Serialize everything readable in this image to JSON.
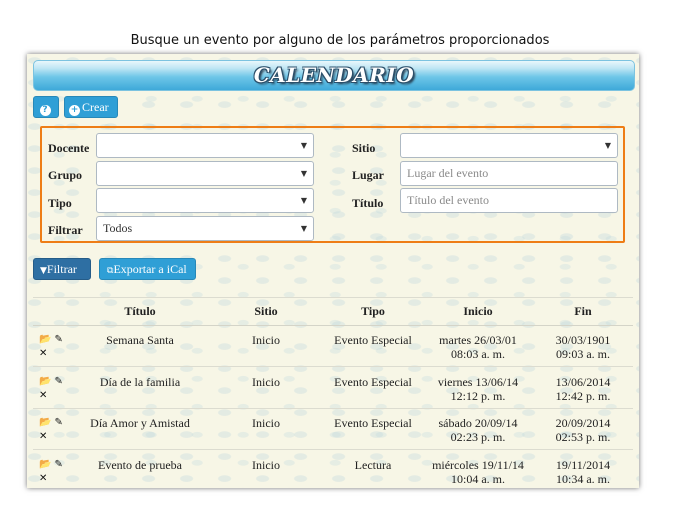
{
  "caption": "Busque un evento por alguno de los parámetros proporcionados",
  "banner_title": "CALENDARIO",
  "toolbar": {
    "help_label": "?",
    "crear_label": "Crear"
  },
  "filters": {
    "docente_label": "Docente",
    "docente_value": "",
    "grupo_label": "Grupo",
    "grupo_value": "",
    "tipo_label": "Tipo",
    "tipo_value": "",
    "filtrar_label": "Filtrar",
    "filtrar_value": "Todos",
    "sitio_label": "Sitio",
    "sitio_value": "",
    "lugar_label": "Lugar",
    "lugar_placeholder": "Lugar del evento",
    "titulo_label": "Título",
    "titulo_placeholder": "Título del evento"
  },
  "actions": {
    "filtrar_button": "Filtrar",
    "ical_button": "Exportar a iCal"
  },
  "table": {
    "headers": [
      "Título",
      "Sitio",
      "Tipo",
      "Inicio",
      "Fin"
    ],
    "rows": [
      {
        "titulo": "Semana Santa",
        "sitio": "Inicio",
        "tipo": "Evento Especial",
        "inicio1": "martes 26/03/01",
        "inicio2": "08:03 a. m.",
        "fin1": "30/03/1901",
        "fin2": "09:03 a. m."
      },
      {
        "titulo": "Día de la familia",
        "sitio": "Inicio",
        "tipo": "Evento Especial",
        "inicio1": "viernes 13/06/14",
        "inicio2": "12:12 p. m.",
        "fin1": "13/06/2014",
        "fin2": "12:42 p. m."
      },
      {
        "titulo": "Día Amor y Amistad",
        "sitio": "Inicio",
        "tipo": "Evento Especial",
        "inicio1": "sábado 20/09/14",
        "inicio2": "02:23 p. m.",
        "fin1": "20/09/2014",
        "fin2": "02:53 p. m."
      },
      {
        "titulo": "Evento de prueba",
        "sitio": "Inicio",
        "tipo": "Lectura",
        "inicio1": "miércoles 19/11/14",
        "inicio2": "10:04 a. m.",
        "fin1": "19/11/2014",
        "fin2": "10:34 a. m."
      }
    ]
  },
  "icons": {
    "row_actions": [
      "folder-open-icon",
      "pencil-icon",
      "delete-x-icon"
    ]
  },
  "colors": {
    "accent": "#2f9fd6",
    "filter_border": "#ee7d16",
    "panel_bg": "#f7f6e6"
  }
}
